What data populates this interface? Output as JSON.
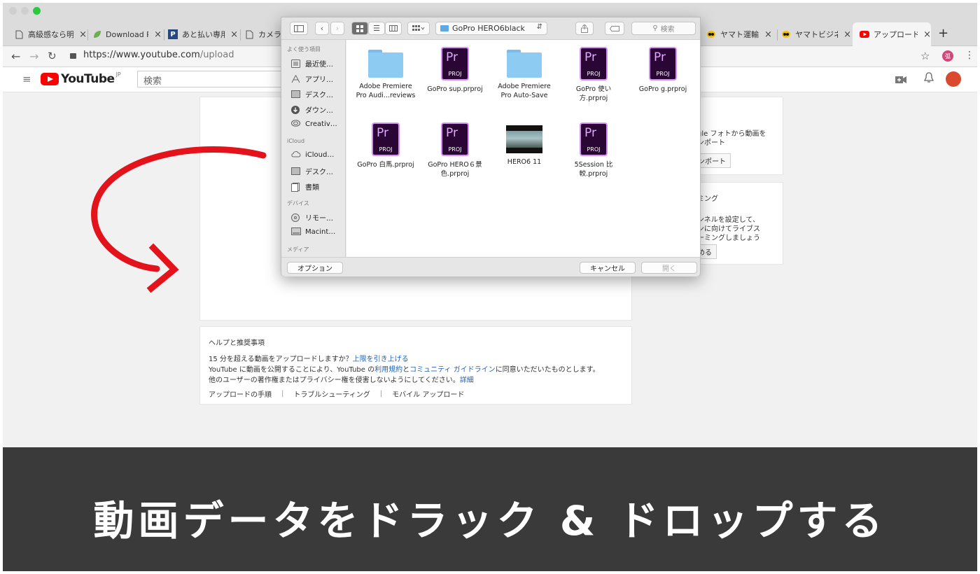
{
  "colors": {
    "accent_red": "#ff0000",
    "link_blue": "#1f62b8",
    "caption_bg": "#3a3a3a",
    "premiere_purple": "#2a0634"
  },
  "browser": {
    "tabs": [
      {
        "icon": "page-icon",
        "label": "高級感なら明",
        "close": "×"
      },
      {
        "icon": "leaf-icon",
        "label": "Download P",
        "close": "×"
      },
      {
        "icon": "p-logo-icon",
        "label": "あと払い専用",
        "close": "×"
      },
      {
        "icon": "page-icon",
        "label": "カメラ",
        "close": ""
      },
      {
        "icon": "yamato-cat-icon",
        "label": "ヤマト運輸",
        "close": "×"
      },
      {
        "icon": "yamato-cat-icon",
        "label": "ヤマトビジネ",
        "close": "×"
      },
      {
        "icon": "youtube-icon",
        "label": "アップロード",
        "close": "×"
      }
    ],
    "new_tab": "+",
    "url_host": "https://www.youtube.com",
    "url_path": "/upload",
    "avatar_initial": "弧"
  },
  "youtube": {
    "logo_text": "YouTube",
    "region": "JP",
    "search_placeholder": "検索"
  },
  "finder": {
    "path_label": "GoPro HERO6black",
    "search_placeholder": "検索",
    "sidebar": {
      "favorites_header": "よく使う項目",
      "favorites": [
        "最近使…",
        "アプリ…",
        "デスク…",
        "ダウン…",
        "Creativ…"
      ],
      "icloud_header": "iCloud",
      "icloud": [
        "iCloud…",
        "デスク…",
        "書類"
      ],
      "devices_header": "デバイス",
      "devices": [
        "リモー…",
        "Macint…"
      ],
      "media_header": "メディア"
    },
    "items": [
      {
        "type": "folder",
        "line1": "Adobe Premiere",
        "line2": "Pro Audi...reviews"
      },
      {
        "type": "premiere",
        "line1": "GoPro sup.prproj",
        "line2": ""
      },
      {
        "type": "folder",
        "line1": "Adobe Premiere",
        "line2": "Pro Auto-Save"
      },
      {
        "type": "premiere",
        "line1": "GoPro 使い",
        "line2": "方.prproj"
      },
      {
        "type": "premiere",
        "line1": "GoPro g.prproj",
        "line2": ""
      },
      {
        "type": "premiere",
        "line1": "GoPro 白馬.prproj",
        "line2": ""
      },
      {
        "type": "premiere",
        "line1": "GoPro HERO６景",
        "line2": "色.prproj"
      },
      {
        "type": "video",
        "line1": "HERO6 11",
        "line2": ""
      },
      {
        "type": "premiere",
        "line1": "5Session 比",
        "line2": "較.prproj"
      }
    ],
    "premiere_badge": "Pr",
    "proj_label": "PROJ",
    "options_button": "オプション",
    "cancel_button": "キャンセル",
    "open_button": "開く"
  },
  "side_panel": {
    "import_text_1": "gle フォトから動画を",
    "import_text_2": "ンポート",
    "import_button": "ンポート",
    "live_title": "ミング",
    "live_text_1": "ンネルを設定して、",
    "live_text_2": "ンに向けてライブス",
    "live_text_3": "ーミングしましょう",
    "live_button": "める"
  },
  "help": {
    "title": "ヘルプと推奨事項",
    "line1_text": "15 分を超える動画をアップロードしますか？",
    "line1_link": "上限を引き上げる",
    "line2_a": "YouTube に動画を公開することにより、YouTube の",
    "line2_link1": "利用規約",
    "line2_b": "と",
    "line2_link2": "コミュニティ ガイドライン",
    "line2_c": "に同意いただいたものとします。",
    "line3_text": "他のユーザーの著作権またはプライバシー権を侵害しないようにしてください。",
    "line3_link": "詳細",
    "link_procedure": "アップロードの手順",
    "link_troubleshoot": "トラブルシューティング",
    "link_mobile": "モバイル アップロード",
    "separator": "|"
  },
  "caption": "動画データをドラック & ドロップする"
}
